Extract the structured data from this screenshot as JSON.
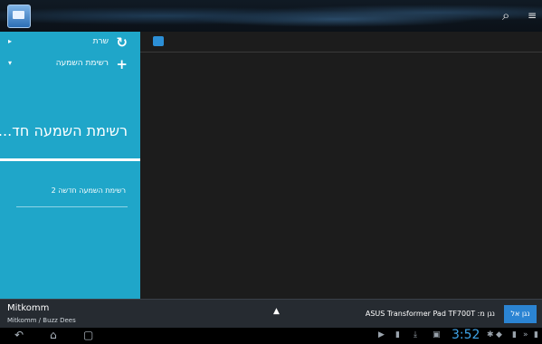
{
  "sidebar": {
    "server_label": "שרת",
    "playlist_label": "רשימת השמעה",
    "current_playlist_title": "רשימת השמעה חד...",
    "playlist_item": "רשימת השמעה חדשה 2"
  },
  "bottom": {
    "user_name": "Mitkomm",
    "user_path": "Mitkomm / Buzz Dees",
    "device_text": "נגן מ: ASUS Transformer Pad TF700T",
    "play_to_button": "נגן אל"
  },
  "status": {
    "clock": "3:52"
  },
  "icons": {
    "search": "search-icon",
    "menu": "overflow-menu-icon",
    "refresh": "refresh-icon",
    "add": "add-icon"
  },
  "colors": {
    "sidebar": "#1fa6c9",
    "accent_button": "#2b84d3",
    "clock": "#3fa4e8"
  }
}
